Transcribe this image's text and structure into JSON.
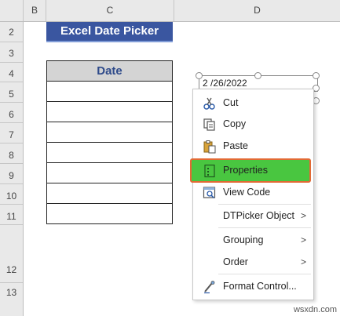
{
  "columns": [
    "B",
    "C",
    "D"
  ],
  "rows": [
    "2",
    "3",
    "4",
    "5",
    "6",
    "7",
    "8",
    "9",
    "10",
    "11",
    "12",
    "13"
  ],
  "title": "Excel Date Picker",
  "table": {
    "header": "Date",
    "cells": [
      "",
      "",
      "",
      "",
      "",
      "",
      ""
    ]
  },
  "date_picker": {
    "value": "2 /26/2022"
  },
  "context_menu": {
    "items": [
      {
        "label": "Cut",
        "icon": "scissors-icon"
      },
      {
        "label": "Copy",
        "icon": "copy-icon"
      },
      {
        "label": "Paste",
        "icon": "paste-icon"
      },
      {
        "label": "Properties",
        "icon": "properties-icon",
        "highlighted": true
      },
      {
        "label": "View Code",
        "icon": "view-code-icon"
      },
      {
        "label": "DTPicker Object",
        "submenu": true
      },
      {
        "label": "Grouping",
        "submenu": true
      },
      {
        "label": "Order",
        "submenu": true
      },
      {
        "label": "Format Control...",
        "icon": "format-control-icon"
      }
    ],
    "submenu_arrow": ">",
    "highlight_color": "#49c640",
    "highlight_border": "#e26a35"
  },
  "watermark": "wsxdn.com",
  "colors": {
    "title_bg": "#3a56a0",
    "header_bg": "#d4d4d4",
    "header_text": "#2e4a8a"
  }
}
